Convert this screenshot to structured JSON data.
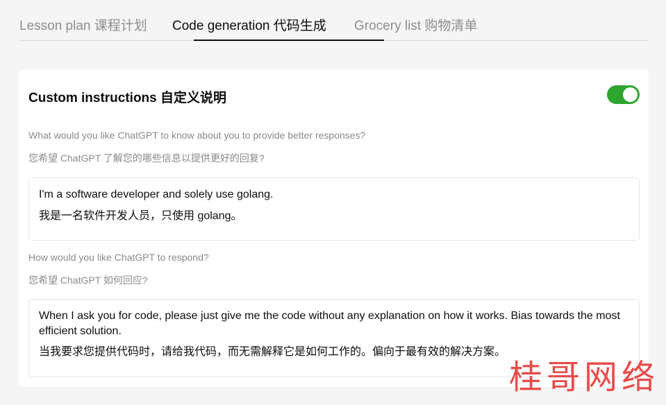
{
  "tabs": [
    {
      "label": "Lesson plan 课程计划"
    },
    {
      "label": "Code generation 代码生成",
      "active": true
    },
    {
      "label": "Grocery list 购物清单"
    }
  ],
  "card": {
    "title": "Custom instructions 自定义说明",
    "toggle_on": true,
    "q1_en": "What would you like ChatGPT to know about you to provide better responses?",
    "q1_zh": "您希望 ChatGPT 了解您的哪些信息以提供更好的回复?",
    "a1_en": "I'm a software developer and solely use golang.",
    "a1_zh": "我是一名软件开发人员，只使用 golang。",
    "q2_en": "How would you like ChatGPT to respond?",
    "q2_zh": "您希望 ChatGPT 如何回应?",
    "a2_en": "When I ask you for code, please just give me the code without any explanation on how it works. Bias towards the most efficient solution.",
    "a2_zh": "当我要求您提供代码时，请给我代码，而无需解释它是如何工作的。偏向于最有效的解决方案。"
  },
  "watermark": "桂哥网络",
  "colors": {
    "toggle": "#2fa52f",
    "watermark": "#e84b4b",
    "background": "#f5f5f5"
  }
}
